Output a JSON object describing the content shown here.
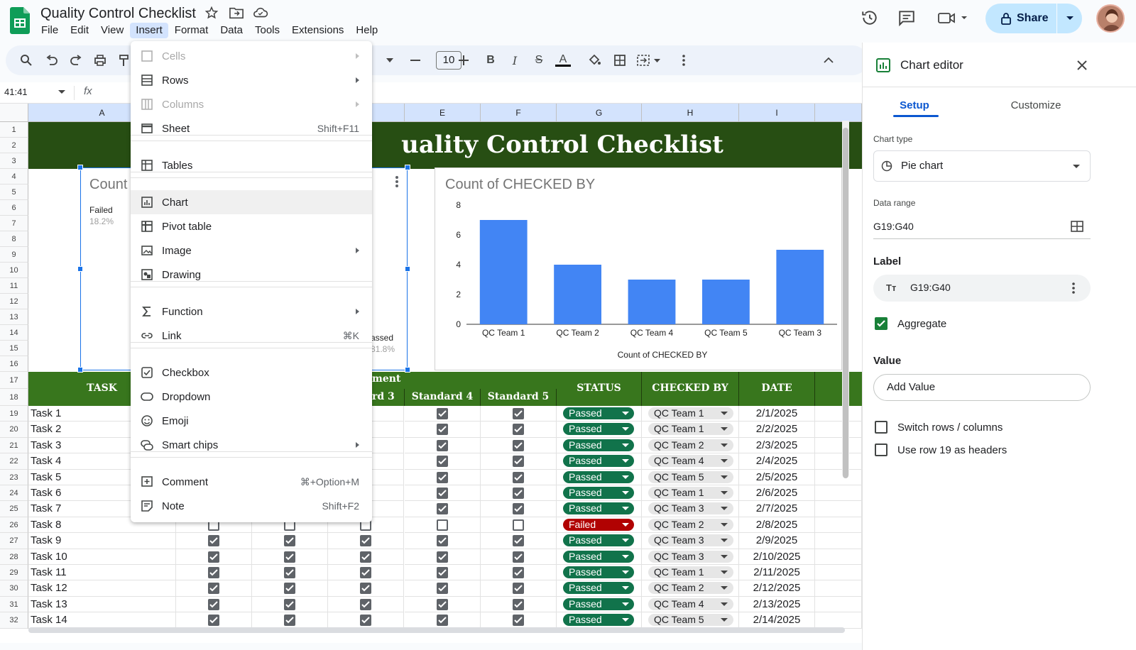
{
  "app": {
    "doc_title": "Quality Control Checklist",
    "menus": [
      "File",
      "Edit",
      "View",
      "Insert",
      "Format",
      "Data",
      "Tools",
      "Extensions",
      "Help"
    ],
    "active_menu": "Insert",
    "share_label": "Share"
  },
  "toolbar": {
    "font_size": "10"
  },
  "formula_bar": {
    "name_box": "41:41",
    "fx": "fx"
  },
  "sheet": {
    "columns": [
      "A",
      "E",
      "F",
      "G",
      "H",
      "I"
    ],
    "title": "Quality Control Checklist",
    "title_visible": "uality Control Checklist",
    "row_numbers": [
      "1",
      "2",
      "3",
      "4",
      "5",
      "6",
      "7",
      "8",
      "9",
      "10",
      "11",
      "12",
      "13",
      "14",
      "15",
      "16",
      "17",
      "18",
      "19",
      "20",
      "21",
      "22",
      "23",
      "24",
      "25",
      "26",
      "27",
      "28",
      "29",
      "30",
      "31",
      "32"
    ],
    "headers": {
      "task": "TASK",
      "group_partial": "ment",
      "standard3_partial": "rd 3",
      "standard4": "Standard 4",
      "standard5": "Standard 5",
      "status": "STATUS",
      "checked_by": "CHECKED BY",
      "date": "DATE"
    },
    "rows": [
      {
        "row": "19",
        "task": "Task 1",
        "s4": true,
        "s5": true,
        "status": "Passed",
        "by": "QC Team 1",
        "date": "2/1/2025"
      },
      {
        "row": "20",
        "task": "Task 2",
        "s4": true,
        "s5": true,
        "status": "Passed",
        "by": "QC Team 1",
        "date": "2/2/2025"
      },
      {
        "row": "21",
        "task": "Task 3",
        "s4": true,
        "s5": true,
        "status": "Passed",
        "by": "QC Team 2",
        "date": "2/3/2025"
      },
      {
        "row": "22",
        "task": "Task 4",
        "s4": true,
        "s5": true,
        "status": "Passed",
        "by": "QC Team 4",
        "date": "2/4/2025"
      },
      {
        "row": "23",
        "task": "Task 5",
        "s4": true,
        "s5": true,
        "status": "Passed",
        "by": "QC Team 5",
        "date": "2/5/2025"
      },
      {
        "row": "24",
        "task": "Task 6",
        "s4": true,
        "s5": true,
        "status": "Passed",
        "by": "QC Team 1",
        "date": "2/6/2025"
      },
      {
        "row": "25",
        "task": "Task 7",
        "s4": true,
        "s5": true,
        "status": "Passed",
        "by": "QC Team 3",
        "date": "2/7/2025"
      },
      {
        "row": "26",
        "task": "Task 8",
        "s4": false,
        "s5": false,
        "status": "Failed",
        "by": "QC Team 2",
        "date": "2/8/2025"
      },
      {
        "row": "27",
        "task": "Task 9",
        "s4": true,
        "s5": true,
        "status": "Passed",
        "by": "QC Team 3",
        "date": "2/9/2025"
      },
      {
        "row": "28",
        "task": "Task 10",
        "s4": true,
        "s5": true,
        "status": "Passed",
        "by": "QC Team 3",
        "date": "2/10/2025"
      },
      {
        "row": "29",
        "task": "Task 11",
        "s4": true,
        "s5": true,
        "status": "Passed",
        "by": "QC Team 1",
        "date": "2/11/2025"
      },
      {
        "row": "30",
        "task": "Task 12",
        "s4": true,
        "s5": true,
        "status": "Passed",
        "by": "QC Team 2",
        "date": "2/12/2025"
      },
      {
        "row": "31",
        "task": "Task 13",
        "s4": true,
        "s5": true,
        "status": "Passed",
        "by": "QC Team 4",
        "date": "2/13/2025"
      },
      {
        "row": "32",
        "task": "Task 14",
        "s4": true,
        "s5": true,
        "status": "Passed",
        "by": "QC Team 5",
        "date": "2/14/2025"
      }
    ]
  },
  "pie_chart": {
    "title_partial": "Count",
    "failed_label": "Failed",
    "failed_pct": "18.2%",
    "passed_label": "Passed",
    "passed_label_visible": "assed",
    "passed_pct": "81.8%"
  },
  "chart_data": {
    "type": "bar",
    "title": "Count of CHECKED BY",
    "xlabel": "Count of CHECKED BY",
    "categories": [
      "QC Team 1",
      "QC Team 2",
      "QC Team 4",
      "QC Team 5",
      "QC Team 3"
    ],
    "values": [
      7,
      4,
      3,
      3,
      5
    ],
    "yticks": [
      "0",
      "2",
      "4",
      "6",
      "8"
    ],
    "ylim": [
      0,
      8
    ],
    "color": "#4285f4",
    "grid": false
  },
  "insert_menu": {
    "items": [
      {
        "label": "Cells",
        "disabled": true,
        "submenu": true,
        "shortcut": "",
        "icon": "cells-icon"
      },
      {
        "label": "Rows",
        "disabled": false,
        "submenu": true,
        "shortcut": "",
        "icon": "rows-icon"
      },
      {
        "label": "Columns",
        "disabled": true,
        "submenu": true,
        "shortcut": "",
        "icon": "columns-icon"
      },
      {
        "label": "Sheet",
        "disabled": false,
        "submenu": false,
        "shortcut": "Shift+F11",
        "icon": "sheet-icon"
      },
      {
        "label": "Tables",
        "disabled": false,
        "submenu": false,
        "shortcut": "",
        "icon": "tables-icon"
      },
      {
        "label": "Chart",
        "disabled": false,
        "submenu": false,
        "shortcut": "",
        "icon": "chart-icon"
      },
      {
        "label": "Pivot table",
        "disabled": false,
        "submenu": false,
        "shortcut": "",
        "icon": "pivot-table-icon"
      },
      {
        "label": "Image",
        "disabled": false,
        "submenu": true,
        "shortcut": "",
        "icon": "image-icon"
      },
      {
        "label": "Drawing",
        "disabled": false,
        "submenu": false,
        "shortcut": "",
        "icon": "drawing-icon"
      },
      {
        "label": "Function",
        "disabled": false,
        "submenu": true,
        "shortcut": "",
        "icon": "function-icon"
      },
      {
        "label": "Link",
        "disabled": false,
        "submenu": false,
        "shortcut": "⌘K",
        "icon": "link-icon"
      },
      {
        "label": "Checkbox",
        "disabled": false,
        "submenu": false,
        "shortcut": "",
        "icon": "checkbox-icon"
      },
      {
        "label": "Dropdown",
        "disabled": false,
        "submenu": false,
        "shortcut": "",
        "icon": "dropdown-icon"
      },
      {
        "label": "Emoji",
        "disabled": false,
        "submenu": false,
        "shortcut": "",
        "icon": "emoji-icon"
      },
      {
        "label": "Smart chips",
        "disabled": false,
        "submenu": true,
        "shortcut": "",
        "icon": "smart-chips-icon"
      },
      {
        "label": "Comment",
        "disabled": false,
        "submenu": false,
        "shortcut": "⌘+Option+M",
        "icon": "comment-icon"
      },
      {
        "label": "Note",
        "disabled": false,
        "submenu": false,
        "shortcut": "Shift+F2",
        "icon": "note-icon"
      }
    ],
    "highlighted": "Chart"
  },
  "chart_editor": {
    "title": "Chart editor",
    "tabs": [
      "Setup",
      "Customize"
    ],
    "active_tab": "Setup",
    "chart_type_label": "Chart type",
    "chart_type_value": "Pie chart",
    "data_range_label": "Data range",
    "data_range_value": "G19:G40",
    "label_section": "Label",
    "label_value": "G19:G40",
    "aggregate_label": "Aggregate",
    "aggregate_checked": true,
    "value_section": "Value",
    "add_value": "Add Value",
    "switch_label": "Switch rows / columns",
    "use_row_label": "Use row 19 as headers"
  }
}
